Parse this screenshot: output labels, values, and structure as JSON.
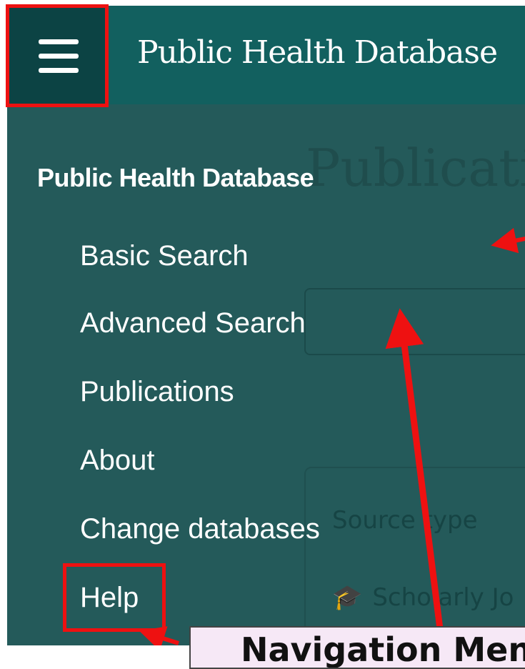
{
  "header": {
    "app_title": "Public Health Database"
  },
  "background": {
    "page_title": "Publicati",
    "source_type_label": "Source type",
    "scholarly_label": "Scholarly Jo"
  },
  "drawer": {
    "title": "Public Health Database",
    "items": [
      {
        "label": "Basic Search"
      },
      {
        "label": "Advanced Search"
      },
      {
        "label": "Publications"
      },
      {
        "label": "About"
      },
      {
        "label": "Change databases"
      },
      {
        "label": "Help"
      }
    ]
  },
  "annotation": {
    "callout_text": "Navigation Menu",
    "highlight_color": "#ee1111"
  },
  "icons": {
    "menu": "hamburger-icon",
    "scholarly": "graduation-cap-icon"
  },
  "colors": {
    "header_bg": "#12605f",
    "menu_button_bg": "#0c4344",
    "drawer_bg": "#245a5a"
  }
}
